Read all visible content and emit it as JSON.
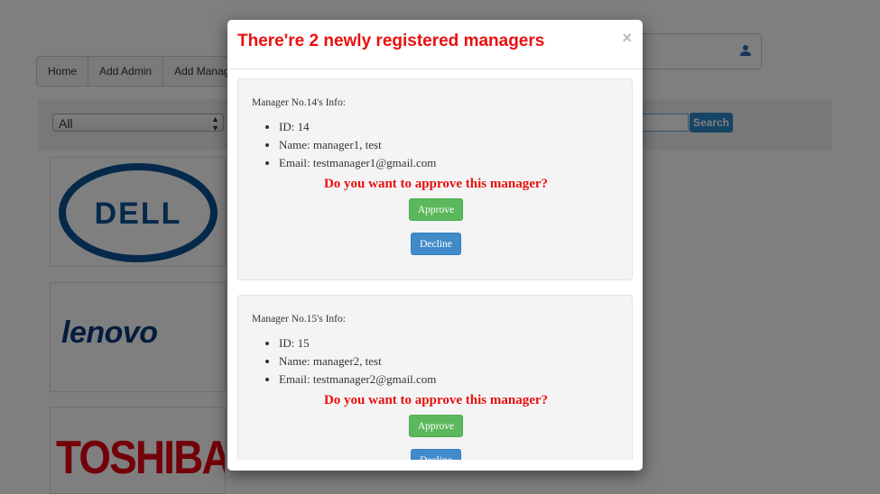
{
  "background": {
    "nav": [
      "Home",
      "Add Admin",
      "Add Manager"
    ],
    "category_select": "All",
    "search_button": "Search",
    "brands": [
      "DELL",
      "lenovo",
      "TOSHIBA"
    ]
  },
  "modal": {
    "title": "There're 2 newly registered managers",
    "close": "×",
    "managers": [
      {
        "heading": "Manager No.14's Info:",
        "id": "ID: 14",
        "name": "Name: manager1, test",
        "email": "Email: testmanager1@gmail.com",
        "question": "Do you want to approve this manager?",
        "approve": "Approve",
        "decline": "Decline"
      },
      {
        "heading": "Manager No.15's Info:",
        "id": "ID: 15",
        "name": "Name: manager2, test",
        "email": "Email: testmanager2@gmail.com",
        "question": "Do you want to approve this manager?",
        "approve": "Approve",
        "decline": "Decline"
      }
    ]
  },
  "colors": {
    "title_red": "#e8100e",
    "approve_green": "#5cb85c",
    "decline_blue": "#428bca",
    "search_blue": "#2a88c8"
  }
}
